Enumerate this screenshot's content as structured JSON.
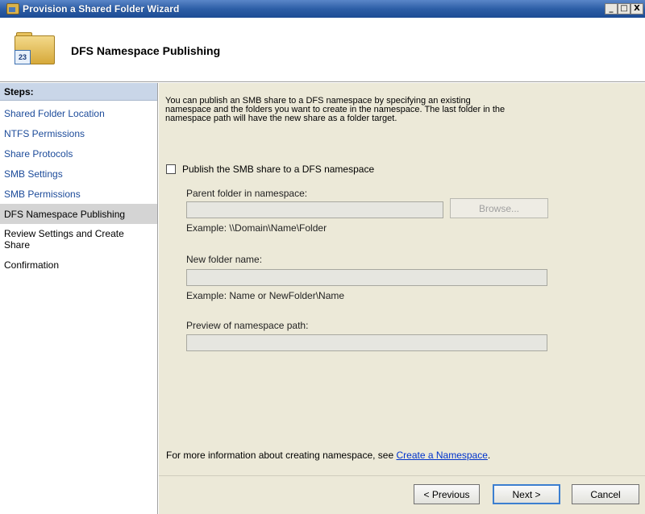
{
  "window": {
    "title": "Provision a Shared Folder Wizard",
    "minimize": "_",
    "maximize": "□",
    "close": "X"
  },
  "header": {
    "title": "DFS Namespace Publishing",
    "icon_badge": "23",
    "icon": "shared-folder-icon"
  },
  "sidebar": {
    "heading": "Steps:",
    "items": [
      {
        "label": "Shared Folder Location"
      },
      {
        "label": "NTFS Permissions"
      },
      {
        "label": "Share Protocols"
      },
      {
        "label": "SMB Settings"
      },
      {
        "label": "SMB Permissions"
      },
      {
        "label": "DFS Namespace Publishing"
      },
      {
        "label": "Review Settings and Create Share"
      },
      {
        "label": "Confirmation"
      }
    ],
    "current_index": 5
  },
  "main": {
    "intro_line1": "You can publish an SMB share to a DFS namespace by specifying an existing",
    "intro_line2": "namespace and the folders you want to create in the namespace. The last folder in the",
    "intro_line3": "namespace path will have the new share as a folder target.",
    "publish_checkbox_label": "Publish the SMB share to a DFS namespace",
    "publish_checked": false,
    "parent_folder_label": "Parent folder in namespace:",
    "parent_folder_value": "",
    "browse_label": "Browse...",
    "parent_example": "Example: \\\\Domain\\Name\\Folder",
    "new_folder_label": "New folder name:",
    "new_folder_value": "",
    "new_folder_example": "Example: Name or NewFolder\\Name",
    "preview_label": "Preview of namespace path:",
    "preview_value": "",
    "more_info_text": "For more information about creating namespace, see",
    "more_info_link": "Create a Namespace",
    "more_info_end": "."
  },
  "footer": {
    "previous_label": "< Previous",
    "next_label": "Next >",
    "cancel_label": "Cancel"
  },
  "colors": {
    "titlebar": "#2d5ea6",
    "steps_header": "#c9d6e8",
    "link": "#1c4b9a",
    "main_bg": "#ece9d8"
  }
}
